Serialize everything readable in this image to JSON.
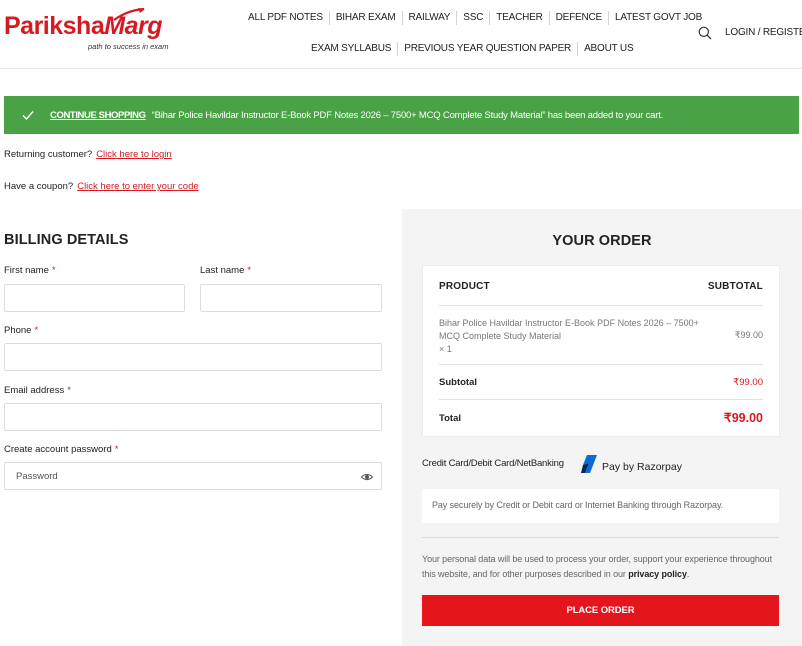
{
  "brand": {
    "part1": "Pariksha",
    "part2": "Marg",
    "tagline": "path to success in exam"
  },
  "nav": {
    "row1": [
      "ALL PDF NOTES",
      "BIHAR EXAM",
      "RAILWAY",
      "SSC",
      "TEACHER",
      "DEFENCE",
      "LATEST GOVT JOB"
    ],
    "row2": [
      "EXAM SYLLABUS",
      "PREVIOUS YEAR QUESTION PAPER",
      "ABOUT US"
    ],
    "login_label": "LOGIN / REGISTER"
  },
  "notice": {
    "continue_label": "CONTINUE SHOPPING",
    "message": "“Bihar Police Havildar Instructor E-Book PDF Notes 2026 – 7500+ MCQ Complete Study Material” has been added to your cart."
  },
  "returning": {
    "text": "Returning customer?",
    "link": "Click here to login"
  },
  "coupon": {
    "text": "Have a coupon?",
    "link": "Click here to enter your code"
  },
  "billing": {
    "title": "BILLING DETAILS",
    "first_name": "First name",
    "last_name": "Last name",
    "phone": "Phone",
    "email": "Email address",
    "password_label": "Create account password",
    "password_placeholder": "Password",
    "required_mark": "*"
  },
  "order": {
    "title": "YOUR ORDER",
    "col_product": "PRODUCT",
    "col_subtotal": "SUBTOTAL",
    "product_name": "Bihar Police Havildar Instructor E-Book PDF Notes 2026 – 7500+ MCQ Complete Study Material",
    "product_qty": "× 1",
    "product_price": "₹99.00",
    "subtotal_label": "Subtotal",
    "subtotal_value": "₹99.00",
    "total_label": "Total",
    "total_value": "₹99.00"
  },
  "payment": {
    "method_label": "Credit Card/Debit Card/NetBanking",
    "provider": "Pay by Razorpay",
    "description": "Pay securely by Credit or Debit card or Internet Banking through Razorpay.",
    "privacy_text": "Your personal data will be used to process your order, support your experience throughout this website, and for other purposes described in our",
    "privacy_link": "privacy policy",
    "place_order": "PLACE ORDER"
  },
  "colors": {
    "brand_red": "#d71920",
    "notice_green": "#4aa246",
    "button_red": "#e5151e",
    "razorpay_blue": "#0c6bd8"
  }
}
